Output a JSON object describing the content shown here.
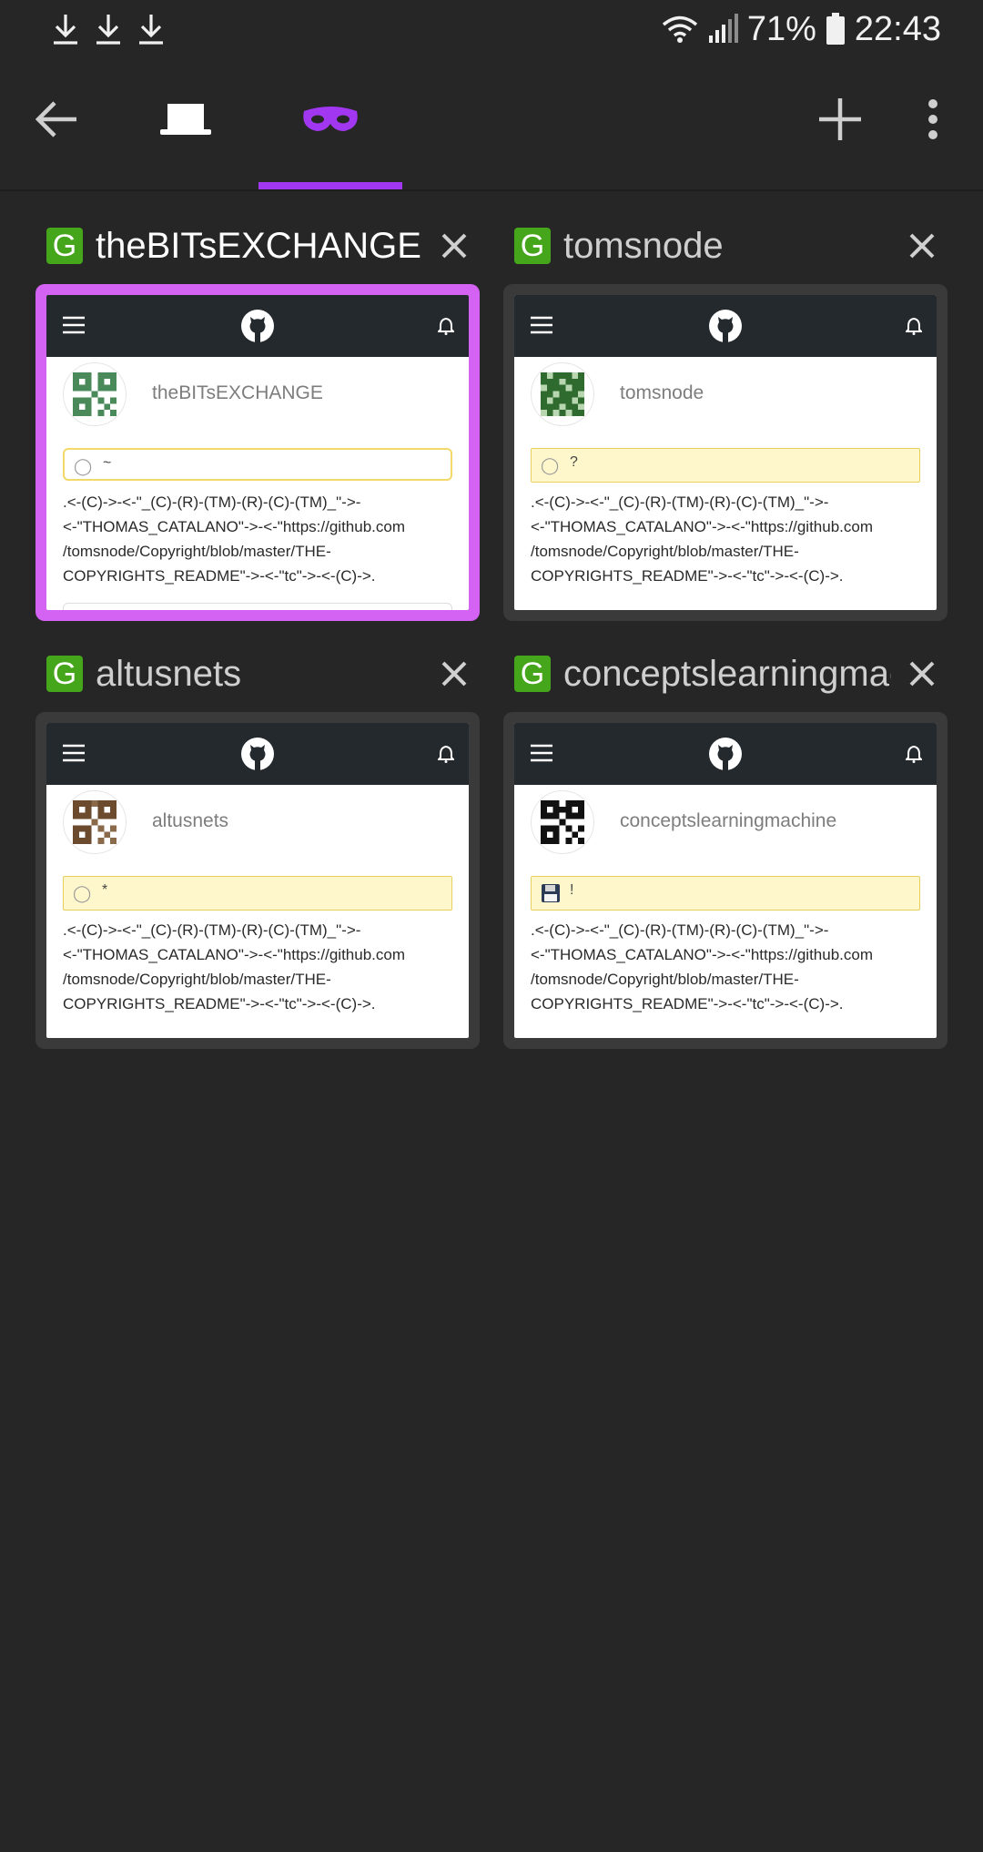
{
  "status_bar": {
    "battery": "71%",
    "time": "22:43"
  },
  "toolbar": {
    "icons": [
      "back-arrow-icon",
      "normal-tabs-icon",
      "private-tabs-mask-icon",
      "new-tab-plus-icon",
      "overflow-menu-icon"
    ],
    "accent": "#a137f0"
  },
  "tabs": [
    {
      "title": "theBITsEXCHANGE",
      "favicon": "G",
      "username": "theBITsEXCHANGE",
      "status_text": "~",
      "bio": ".<-(C)->-<-\"_(C)-(R)-(TM)-(R)-(C)-(TM)_\"->-\n<-\"THOMAS_CATALANO\"->-<-\"https://github.com\n/tomsnode/Copyright/blob/master/THE-\nCOPYRIGHTS_README\"->-<-\"tc\"->-<-(C)->.",
      "active": true
    },
    {
      "title": "tomsnode",
      "favicon": "G",
      "username": "tomsnode",
      "status_text": "?",
      "bio": ".<-(C)->-<-\"_(C)-(R)-(TM)-(R)-(C)-(TM)_\"->-\n<-\"THOMAS_CATALANO\"->-<-\"https://github.com\n/tomsnode/Copyright/blob/master/THE-\nCOPYRIGHTS_README\"->-<-\"tc\"->-<-(C)->.",
      "active": false
    },
    {
      "title": "altusnets",
      "favicon": "G",
      "username": "altusnets",
      "status_text": "*",
      "bio": ".<-(C)->-<-\"_(C)-(R)-(TM)-(R)-(C)-(TM)_\"->-\n<-\"THOMAS_CATALANO\"->-<-\"https://github.com\n/tomsnode/Copyright/blob/master/THE-\nCOPYRIGHTS_README\"->-<-\"tc\"->-<-(C)->.",
      "active": false
    },
    {
      "title": "conceptslearningmachine",
      "favicon": "G",
      "username": "conceptslearningmachine",
      "status_text": "!",
      "bio": ".<-(C)->-<-\"_(C)-(R)-(TM)-(R)-(C)-(TM)_\"->-\n<-\"THOMAS_CATALANO\"->-<-\"https://github.com\n/tomsnode/Copyright/blob/master/THE-\nCOPYRIGHTS_README\"->-<-\"tc\"->-<-(C)->.",
      "active": false
    }
  ]
}
